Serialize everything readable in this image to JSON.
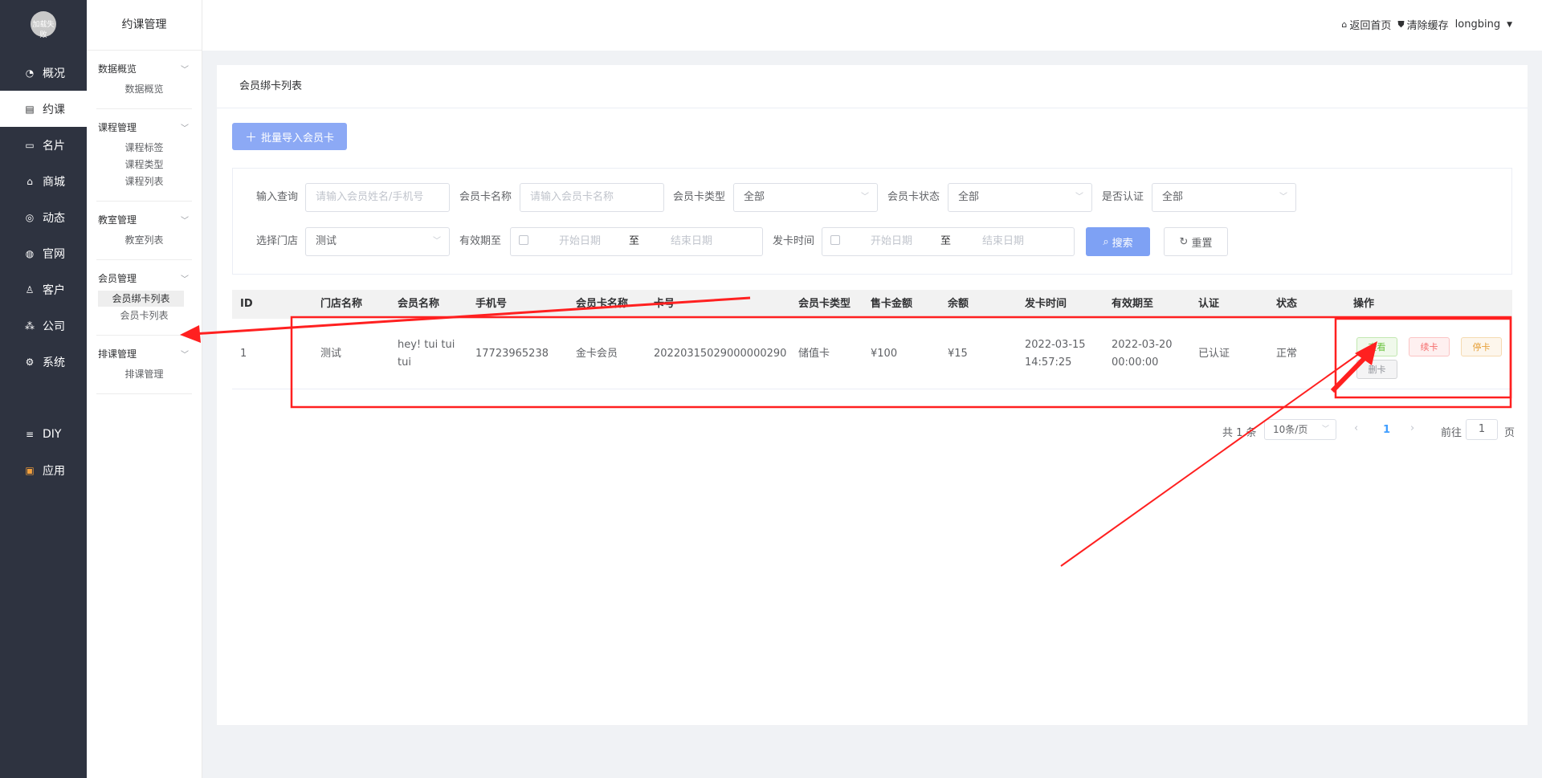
{
  "nav": {
    "logo_text": "加载失败",
    "items": [
      {
        "label": "概况",
        "icon": "pie-chart-icon"
      },
      {
        "label": "约课",
        "icon": "calendar-icon"
      },
      {
        "label": "名片",
        "icon": "card-icon"
      },
      {
        "label": "商城",
        "icon": "shop-icon"
      },
      {
        "label": "动态",
        "icon": "compass-icon"
      },
      {
        "label": "官网",
        "icon": "globe-icon"
      },
      {
        "label": "客户",
        "icon": "user-icon"
      },
      {
        "label": "公司",
        "icon": "org-icon"
      },
      {
        "label": "系统",
        "icon": "gear-icon"
      },
      {
        "label": "DIY",
        "icon": "diy-icon"
      },
      {
        "label": "应用",
        "icon": "apps-icon"
      }
    ]
  },
  "submenu": {
    "title": "约课管理",
    "groups": [
      {
        "title": "数据概览",
        "items": [
          "数据概览"
        ]
      },
      {
        "title": "课程管理",
        "items": [
          "课程标签",
          "课程类型",
          "课程列表"
        ]
      },
      {
        "title": "教室管理",
        "items": [
          "教室列表"
        ]
      },
      {
        "title": "会员管理",
        "items": [
          "会员绑卡列表",
          "会员卡列表"
        ]
      },
      {
        "title": "排课管理",
        "items": [
          "排课管理"
        ]
      }
    ]
  },
  "header": {
    "home": "返回首页",
    "clear_cache": "清除缓存",
    "user": "longbing"
  },
  "page": {
    "title": "会员绑卡列表",
    "import_button": "批量导入会员卡"
  },
  "filters": {
    "query_label": "输入查询",
    "query_placeholder": "请输入会员姓名/手机号",
    "card_name_label": "会员卡名称",
    "card_name_placeholder": "请输入会员卡名称",
    "card_type_label": "会员卡类型",
    "card_type_value": "全部",
    "card_status_label": "会员卡状态",
    "card_status_value": "全部",
    "verified_label": "是否认证",
    "verified_value": "全部",
    "store_label": "选择门店",
    "store_value": "测试",
    "valid_label": "有效期至",
    "issue_label": "发卡时间",
    "start_placeholder": "开始日期",
    "end_placeholder": "结束日期",
    "range_sep": "至",
    "search_button": "搜索",
    "reset_button": "重置"
  },
  "table": {
    "columns": [
      "ID",
      "门店名称",
      "会员名称",
      "手机号",
      "会员卡名称",
      "卡号",
      "会员卡类型",
      "售卡金额",
      "余额",
      "发卡时间",
      "有效期至",
      "认证",
      "状态",
      "操作"
    ],
    "rows": [
      {
        "id": "1",
        "store": "测试",
        "member_line1": "hey!  tui tui",
        "member_line2": "tui",
        "phone": "17723965238",
        "card_name": "金卡会员",
        "card_no": "20220315029000000290",
        "card_type": "储值卡",
        "price": "¥100",
        "balance": "¥15",
        "issue_date": "2022-03-15",
        "issue_time": "14:57:25",
        "valid_date": "2022-03-20",
        "valid_time": "00:00:00",
        "verified": "已认证",
        "status": "正常",
        "actions": [
          "查看",
          "续卡",
          "停卡",
          "删卡"
        ]
      }
    ]
  },
  "pagination": {
    "total": "共 1 条",
    "page_size": "10条/页",
    "current_page": "1",
    "goto_label": "前往",
    "goto_value": "1",
    "page_suffix": "页"
  },
  "colors": {
    "primary": "#7ea1f4",
    "nav_bg": "#2e3340",
    "annotation": "#ff2020"
  }
}
